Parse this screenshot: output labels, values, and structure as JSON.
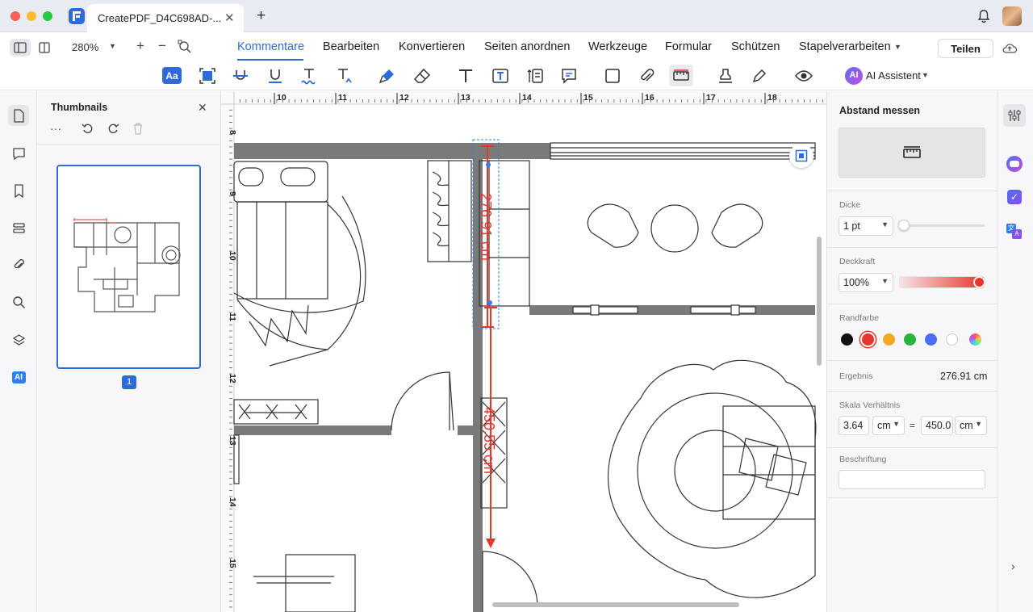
{
  "window": {
    "tab_title": "CreatePDF_D4C698AD-...",
    "close_tab": "✕",
    "new_tab": "+"
  },
  "toolbar": {
    "zoom": "280%",
    "zoom_in": "+",
    "zoom_out": "−",
    "share": "Teilen"
  },
  "menu": [
    {
      "label": "Kommentare",
      "active": true
    },
    {
      "label": "Bearbeiten"
    },
    {
      "label": "Konvertieren"
    },
    {
      "label": "Seiten anordnen"
    },
    {
      "label": "Werkzeuge"
    },
    {
      "label": "Formular"
    },
    {
      "label": "Schützen"
    },
    {
      "label": "Stapelverarbeiten"
    }
  ],
  "tools": {
    "ai_assistant": "AI Assistent",
    "text_box": "Aa"
  },
  "thumbnails": {
    "title": "Thumbnails",
    "more": "···",
    "close": "✕",
    "page_number": "1"
  },
  "ruler": {
    "h_ticks": [
      "10",
      "11",
      "12",
      "13",
      "14",
      "15",
      "16",
      "17",
      "18"
    ],
    "v_ticks": [
      "8",
      "9",
      "10",
      "11",
      "12",
      "13",
      "14",
      "15"
    ]
  },
  "drawing": {
    "measure1": "276.91 cm",
    "measure2": "450.55 cm"
  },
  "panel": {
    "title": "Abstand messen",
    "thickness_label": "Dicke",
    "thickness_value": "1 pt",
    "opacity_label": "Deckkraft",
    "opacity_value": "100%",
    "border_color_label": "Randfarbe",
    "colors": [
      "#111111",
      "#e8362c",
      "#f5a623",
      "#27b43e",
      "#4b6ef5",
      "#ffffff"
    ],
    "result_label": "Ergebnis",
    "result_value": "276.91 cm",
    "scale_label": "Skala Verhältnis",
    "scale_from": "3.64",
    "scale_from_unit": "cm",
    "scale_eq": "=",
    "scale_to": "450.0",
    "scale_to_unit": "cm",
    "caption_label": "Beschriftung",
    "caption_value": ""
  },
  "accent": "#2f6ad9"
}
